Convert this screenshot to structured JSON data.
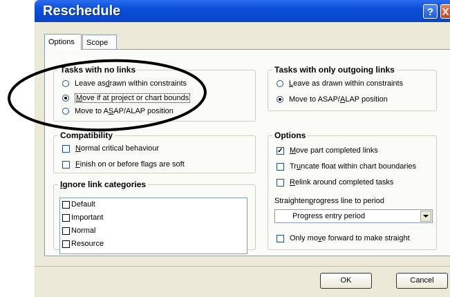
{
  "window": {
    "title": "Reschedule",
    "help_label": "?",
    "close_label": "X"
  },
  "tabs": [
    {
      "label": "Options"
    },
    {
      "label": "Scope"
    }
  ],
  "no_links": {
    "title": "Tasks with no links",
    "options": [
      {
        "pre": "Leave as ",
        "key": "d",
        "post": "rawn within constraints",
        "selected": false
      },
      {
        "pre": "",
        "key": "M",
        "post": "ove if at project or chart bounds",
        "selected": true
      },
      {
        "pre": "Move to A",
        "key": "S",
        "post": "AP/ALAP position",
        "selected": false
      }
    ]
  },
  "outgoing_links": {
    "title": "Tasks with only outgoing links",
    "options": [
      {
        "pre": "",
        "key": "L",
        "post": "eave as drawn within constraints",
        "selected": false
      },
      {
        "pre": "Move to ASAP/",
        "key": "A",
        "post": "LAP position",
        "selected": true
      }
    ]
  },
  "compatibility": {
    "title": "Compatibility",
    "options": [
      {
        "pre": "",
        "key": "N",
        "post": "ormal critical behaviour",
        "checked": false
      },
      {
        "pre": "",
        "key": "F",
        "post": "inish on or before flags are soft",
        "checked": false
      }
    ]
  },
  "options_group": {
    "title": "Options",
    "options": [
      {
        "pre": "",
        "key": "M",
        "post": "ove part completed links",
        "checked": true
      },
      {
        "pre": "Tr",
        "key": "u",
        "post": "ncate float within chart boundaries",
        "checked": false
      },
      {
        "pre": "",
        "key": "R",
        "post": "elink around completed tasks",
        "checked": false
      }
    ],
    "straighten_label_pre": "Straighten ",
    "straighten_label_key": "p",
    "straighten_label_post": "rogress line to period",
    "period_value": "Progress entry period",
    "forward": {
      "pre": "Only mo",
      "key": "v",
      "post": "e forward to make straight",
      "checked": false
    }
  },
  "ignore": {
    "title_key": "I",
    "title_rest": "gnore link categories",
    "items": [
      "Default",
      "Important",
      "Normal",
      "Resource"
    ]
  },
  "buttons": {
    "ok": "OK",
    "cancel": "Cancel"
  }
}
